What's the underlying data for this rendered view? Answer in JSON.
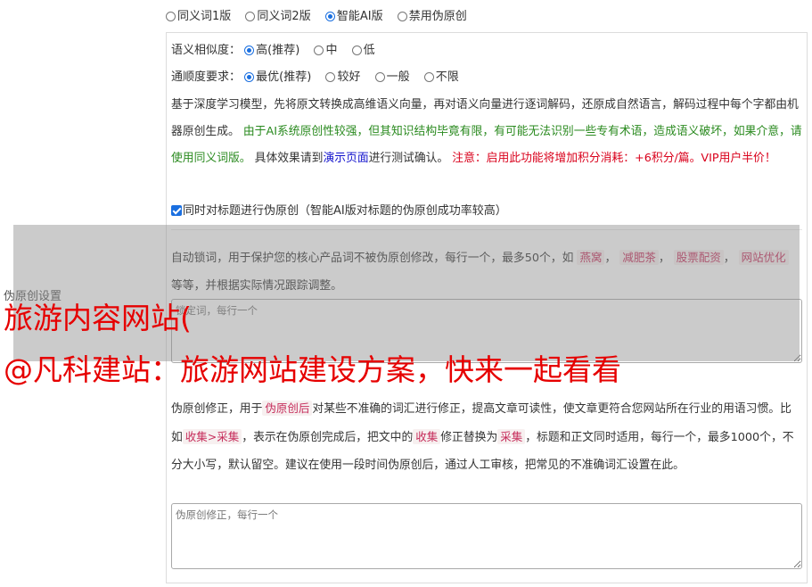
{
  "modes": [
    {
      "label": "同义词1版",
      "checked": false
    },
    {
      "label": "同义词2版",
      "checked": false
    },
    {
      "label": "智能AI版",
      "checked": true
    },
    {
      "label": "禁用伪原创",
      "checked": false
    }
  ],
  "similarity": {
    "label": "语义相似度：",
    "options": [
      {
        "label": "高(推荐)",
        "checked": true
      },
      {
        "label": "中",
        "checked": false
      },
      {
        "label": "低",
        "checked": false
      }
    ]
  },
  "fluency": {
    "label": "通顺度要求：",
    "options": [
      {
        "label": "最优(推荐)",
        "checked": true
      },
      {
        "label": "较好",
        "checked": false
      },
      {
        "label": "一般",
        "checked": false
      },
      {
        "label": "不限",
        "checked": false
      }
    ]
  },
  "description": {
    "part1": "基于深度学习模型，先将原文转换成高维语义向量，再对语义向量进行逐词解码，还原成自然语言，解码过程中每个字都由机器原创生成。",
    "warning_green": "由于AI系统原创性较强，但其知识结构毕竟有限，有可能无法识别一些专有术语，造成语义破坏，如果介意，请使用同义词版。",
    "part2": "具体效果请到",
    "link": "演示页面",
    "part3": "进行测试确认。",
    "warning_red": "注意：启用此功能将增加积分消耗：+6积分/篇。VIP用户半价！"
  },
  "title_checkbox": {
    "label": "同时对标题进行伪原创（智能AI版对标题的伪原创成功率较高）",
    "checked": true
  },
  "section_label": "伪原创设置",
  "lock_words": {
    "text1": "自动锁词，用于保护您的核心产品词不被伪原创修改，每行一个，最多50个，如",
    "examples": [
      "燕窝",
      "减肥茶",
      "股票配资",
      "网站优化"
    ],
    "text2": "等等，并根据实际情况跟踪调整。",
    "placeholder": "锁定词，每行一个"
  },
  "corrections": {
    "text1": "伪原创修正，用于",
    "tag1": "伪原创后",
    "text2": "对某些不准确的词汇进行修正，提高文章可读性，使文章更符合您网站所在行业的用语习惯。比如",
    "tag2": "收集>采集",
    "text3": "，表示在伪原创完成后，把文中的",
    "tag3": "收集",
    "text4": "修正替换为",
    "tag4": "采集",
    "text5": "，标题和正文同时适用，每行一个，最多1000个，不分大小写，默认留空。建议在使用一段时间伪原创后，通过人工审核，把常见的不准确词汇设置在此。",
    "placeholder": "伪原创修正，每行一个"
  },
  "overlay": {
    "line1": "旅游内容网站(",
    "line2": "@凡科建站：旅游网站建设方案，快来一起看看"
  },
  "colors": {
    "accent": "#1a6fe0",
    "green": "#2a8a1f",
    "red": "#d9001b",
    "overlay_text": "#e60000"
  }
}
